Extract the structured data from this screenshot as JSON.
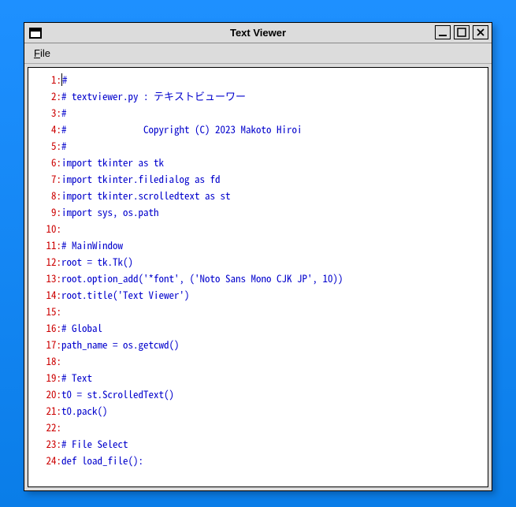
{
  "window": {
    "title": "Text Viewer"
  },
  "menubar": {
    "file": {
      "label": "File",
      "mnemonic_index": 0
    }
  },
  "colors": {
    "line_number": "#cc0000",
    "code_text": "#0000cc"
  },
  "editor": {
    "cursor_line": 1,
    "lines": [
      "#",
      "# textviewer.py : テキストビューワー",
      "#",
      "#               Copyright (C) 2023 Makoto Hiroi",
      "#",
      "import tkinter as tk",
      "import tkinter.filedialog as fd",
      "import tkinter.scrolledtext as st",
      "import sys, os.path",
      "",
      "# MainWindow",
      "root = tk.Tk()",
      "root.option_add('*font', ('Noto Sans Mono CJK JP', 10))",
      "root.title('Text Viewer')",
      "",
      "# Global",
      "path_name = os.getcwd()",
      "",
      "# Text",
      "t0 = st.ScrolledText()",
      "t0.pack()",
      "",
      "# File Select",
      "def load_file():"
    ]
  }
}
